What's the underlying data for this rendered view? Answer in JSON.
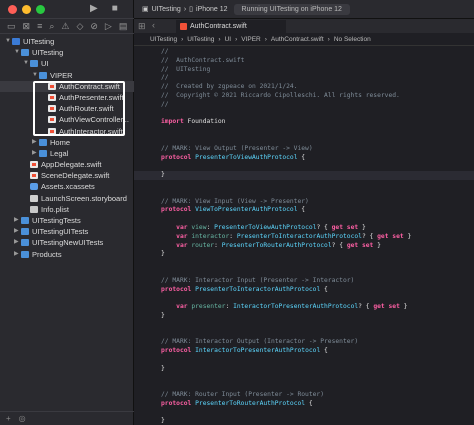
{
  "window": {
    "scheme": "UITesting",
    "device": "iPhone 12",
    "status": "Running UITesting on iPhone 12",
    "traffic_colors": [
      "#ff5f57",
      "#febc2e",
      "#28c840"
    ]
  },
  "navigator": {
    "tree": [
      {
        "label": "UITesting",
        "depth": 0,
        "icon": "project",
        "disclosure": "open"
      },
      {
        "label": "UITesting",
        "depth": 1,
        "icon": "folder",
        "disclosure": "open"
      },
      {
        "label": "UI",
        "depth": 2,
        "icon": "folder",
        "disclosure": "open"
      },
      {
        "label": "VIPER",
        "depth": 3,
        "icon": "folder",
        "disclosure": "open"
      },
      {
        "label": "AuthContract.swift",
        "depth": 4,
        "icon": "swift",
        "selected": true
      },
      {
        "label": "AuthPresenter.swift",
        "depth": 4,
        "icon": "swift"
      },
      {
        "label": "AuthRouter.swift",
        "depth": 4,
        "icon": "swift"
      },
      {
        "label": "AuthViewController...",
        "depth": 4,
        "icon": "swift"
      },
      {
        "label": "AuthInteractor.swift",
        "depth": 4,
        "icon": "swift"
      },
      {
        "label": "Home",
        "depth": 3,
        "icon": "folder",
        "disclosure": "closed"
      },
      {
        "label": "Legal",
        "depth": 3,
        "icon": "folder",
        "disclosure": "closed"
      },
      {
        "label": "AppDelegate.swift",
        "depth": 2,
        "icon": "swift"
      },
      {
        "label": "SceneDelegate.swift",
        "depth": 2,
        "icon": "swift"
      },
      {
        "label": "Assets.xcassets",
        "depth": 2,
        "icon": "assets"
      },
      {
        "label": "LaunchScreen.storyboard",
        "depth": 2,
        "icon": "storyboard"
      },
      {
        "label": "Info.plist",
        "depth": 2,
        "icon": "plist"
      },
      {
        "label": "UITestingTests",
        "depth": 1,
        "icon": "folder",
        "disclosure": "closed"
      },
      {
        "label": "UITestingUITests",
        "depth": 1,
        "icon": "folder",
        "disclosure": "closed"
      },
      {
        "label": "UITestingNewUITests",
        "depth": 1,
        "icon": "folder",
        "disclosure": "closed"
      },
      {
        "label": "Products",
        "depth": 1,
        "icon": "folder",
        "disclosure": "closed"
      }
    ]
  },
  "editor": {
    "tab_label": "AuthContract.swift",
    "jumpbar": [
      "UITesting",
      "UITesting",
      "UI",
      "VIPER",
      "AuthContract.swift",
      "No Selection"
    ],
    "lines": [
      [
        [
          "c",
          "//"
        ]
      ],
      [
        [
          "c",
          "//  AuthContract.swift"
        ]
      ],
      [
        [
          "c",
          "//  UITesting"
        ]
      ],
      [
        [
          "c",
          "//"
        ]
      ],
      [
        [
          "c",
          "//  Created by zgpeace on 2021/1/24."
        ]
      ],
      [
        [
          "c",
          "//  Copyright © 2021 Riccardo Cipolleschi. All rights reserved."
        ]
      ],
      [
        [
          "c",
          "//"
        ]
      ],
      [],
      [
        [
          "k",
          "import"
        ],
        [
          "n",
          " Foundation"
        ]
      ],
      [],
      [],
      [
        [
          "c",
          "// MARK: View Output (Presenter -> View)"
        ]
      ],
      [
        [
          "k",
          "protocol"
        ],
        [
          "n",
          " "
        ],
        [
          "t",
          "PresenterToViewAuthProtocol"
        ],
        [
          "n",
          " {"
        ]
      ],
      [],
      [
        [
          "n",
          "}"
        ]
      ],
      [],
      [],
      [
        [
          "c",
          "// MARK: View Input (View -> Presenter)"
        ]
      ],
      [
        [
          "k",
          "protocol"
        ],
        [
          "n",
          " "
        ],
        [
          "t",
          "ViewToPresenterAuthProtocol"
        ],
        [
          "n",
          " {"
        ]
      ],
      [],
      [
        [
          "n",
          "    "
        ],
        [
          "k",
          "var"
        ],
        [
          "n",
          " "
        ],
        [
          "v",
          "view"
        ],
        [
          "n",
          ": "
        ],
        [
          "t",
          "PresenterToViewAuthProtocol"
        ],
        [
          "n",
          "? { "
        ],
        [
          "k",
          "get set"
        ],
        [
          "n",
          " }"
        ]
      ],
      [
        [
          "n",
          "    "
        ],
        [
          "k",
          "var"
        ],
        [
          "n",
          " "
        ],
        [
          "v",
          "interactor"
        ],
        [
          "n",
          ": "
        ],
        [
          "t",
          "PresenterToInteractorAuthProtocol"
        ],
        [
          "n",
          "? { "
        ],
        [
          "k",
          "get set"
        ],
        [
          "n",
          " }"
        ]
      ],
      [
        [
          "n",
          "    "
        ],
        [
          "k",
          "var"
        ],
        [
          "n",
          " "
        ],
        [
          "v",
          "router"
        ],
        [
          "n",
          ": "
        ],
        [
          "t",
          "PresenterToRouterAuthProtocol"
        ],
        [
          "n",
          "? { "
        ],
        [
          "k",
          "get set"
        ],
        [
          "n",
          " }"
        ]
      ],
      [
        [
          "n",
          "}"
        ]
      ],
      [],
      [],
      [
        [
          "c",
          "// MARK: Interactor Input (Presenter -> Interactor)"
        ]
      ],
      [
        [
          "k",
          "protocol"
        ],
        [
          "n",
          " "
        ],
        [
          "t",
          "PresenterToInteractorAuthProtocol"
        ],
        [
          "n",
          " {"
        ]
      ],
      [],
      [
        [
          "n",
          "    "
        ],
        [
          "k",
          "var"
        ],
        [
          "n",
          " "
        ],
        [
          "v",
          "presenter"
        ],
        [
          "n",
          ": "
        ],
        [
          "t",
          "InteractorToPresenterAuthProtocol"
        ],
        [
          "n",
          "? { "
        ],
        [
          "k",
          "get set"
        ],
        [
          "n",
          " }"
        ]
      ],
      [
        [
          "n",
          "}"
        ]
      ],
      [],
      [],
      [
        [
          "c",
          "// MARK: Interactor Output (Interactor -> Presenter)"
        ]
      ],
      [
        [
          "k",
          "protocol"
        ],
        [
          "n",
          " "
        ],
        [
          "t",
          "InteractorToPresenterAuthProtocol"
        ],
        [
          "n",
          " {"
        ]
      ],
      [],
      [
        [
          "n",
          "}"
        ]
      ],
      [],
      [],
      [
        [
          "c",
          "// MARK: Router Input (Presenter -> Router)"
        ]
      ],
      [
        [
          "k",
          "protocol"
        ],
        [
          "n",
          " "
        ],
        [
          "t",
          "PresenterToRouterAuthProtocol"
        ],
        [
          "n",
          " {"
        ]
      ],
      [],
      [
        [
          "n",
          "}"
        ]
      ]
    ],
    "highlight_line": 14
  }
}
